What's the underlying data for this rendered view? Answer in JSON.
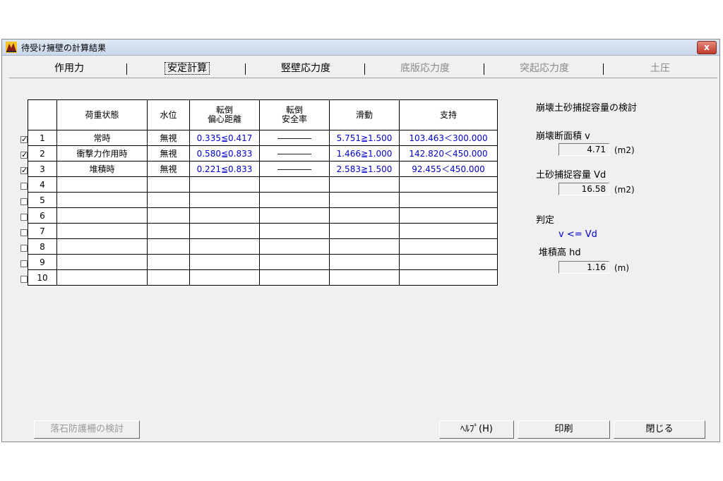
{
  "window": {
    "title": "待受け擁壁の計算結果",
    "close_label": "x"
  },
  "tabs": [
    {
      "label": "作用力",
      "state": "normal"
    },
    {
      "label": "安定計算",
      "state": "active"
    },
    {
      "label": "竪壁応力度",
      "state": "normal"
    },
    {
      "label": "底版応力度",
      "state": "disabled"
    },
    {
      "label": "突起応力度",
      "state": "disabled"
    },
    {
      "label": "土圧",
      "state": "disabled"
    }
  ],
  "table": {
    "headers": {
      "case": "荷重状態",
      "water": "水位",
      "overturn_ecc_1": "転倒",
      "overturn_ecc_2": "偏心距離",
      "overturn_sf_1": "転倒",
      "overturn_sf_2": "安全率",
      "sliding": "滑動",
      "bearing": "支持"
    },
    "rows": [
      {
        "checked": true,
        "no": "1",
        "case": "常時",
        "water": "無視",
        "ecc": "0.335≦0.417",
        "sf": "――――",
        "sliding": "5.751≧1.500",
        "bearing": "103.463＜300.000"
      },
      {
        "checked": true,
        "no": "2",
        "case": "衝撃力作用時",
        "water": "無視",
        "ecc": "0.580≦0.833",
        "sf": "――――",
        "sliding": "1.466≧1.000",
        "bearing": "142.820＜450.000"
      },
      {
        "checked": true,
        "no": "3",
        "case": "堆積時",
        "water": "無視",
        "ecc": "0.221≦0.833",
        "sf": "――――",
        "sliding": "2.583≧1.500",
        "bearing": "92.455＜450.000"
      },
      {
        "checked": false,
        "no": "4",
        "case": "",
        "water": "",
        "ecc": "",
        "sf": "",
        "sliding": "",
        "bearing": ""
      },
      {
        "checked": false,
        "no": "5",
        "case": "",
        "water": "",
        "ecc": "",
        "sf": "",
        "sliding": "",
        "bearing": ""
      },
      {
        "checked": false,
        "no": "6",
        "case": "",
        "water": "",
        "ecc": "",
        "sf": "",
        "sliding": "",
        "bearing": ""
      },
      {
        "checked": false,
        "no": "7",
        "case": "",
        "water": "",
        "ecc": "",
        "sf": "",
        "sliding": "",
        "bearing": ""
      },
      {
        "checked": false,
        "no": "8",
        "case": "",
        "water": "",
        "ecc": "",
        "sf": "",
        "sliding": "",
        "bearing": ""
      },
      {
        "checked": false,
        "no": "9",
        "case": "",
        "water": "",
        "ecc": "",
        "sf": "",
        "sliding": "",
        "bearing": ""
      },
      {
        "checked": false,
        "no": "10",
        "case": "",
        "water": "",
        "ecc": "",
        "sf": "",
        "sliding": "",
        "bearing": ""
      }
    ]
  },
  "side": {
    "heading": "崩壊土砂捕捉容量の検討",
    "area_label": "崩壊断面積 v",
    "area_value": "4.71",
    "area_unit": "(m2)",
    "capacity_label": "土砂捕捉容量 Vd",
    "capacity_value": "16.58",
    "capacity_unit": "(m2)",
    "judge_label": "判定",
    "judge_value": "v <= Vd",
    "height_label": "堆積高 hd",
    "height_value": "1.16",
    "height_unit": "(m)"
  },
  "buttons": {
    "rockfall": "落石防護柵の検討",
    "help": "ﾍﾙﾌﾟ(H)",
    "print": "印刷",
    "close": "閉じる"
  },
  "colors": {
    "value_blue": "#0000cc",
    "judge_blue": "#0000cc"
  }
}
